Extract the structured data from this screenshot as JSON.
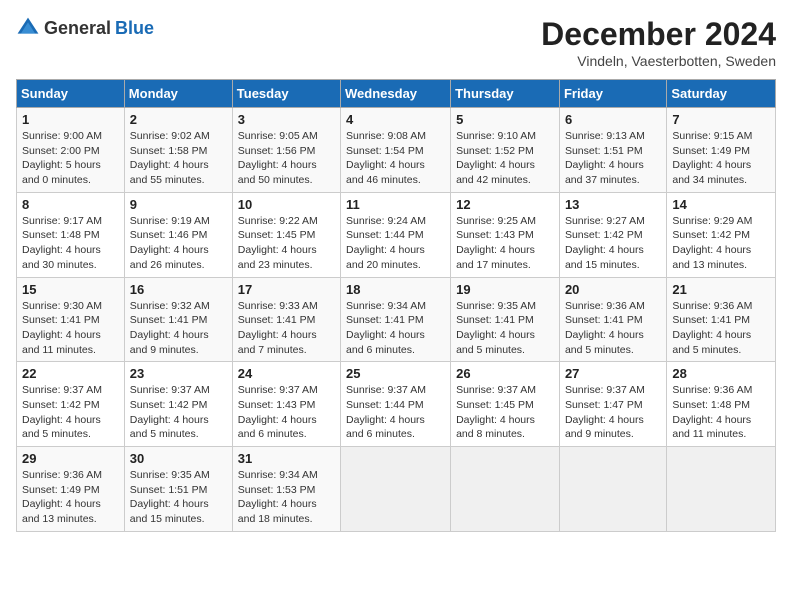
{
  "header": {
    "logo_general": "General",
    "logo_blue": "Blue",
    "month_title": "December 2024",
    "subtitle": "Vindeln, Vaesterbotten, Sweden"
  },
  "days_of_week": [
    "Sunday",
    "Monday",
    "Tuesday",
    "Wednesday",
    "Thursday",
    "Friday",
    "Saturday"
  ],
  "weeks": [
    [
      {
        "day": "1",
        "sunrise": "Sunrise: 9:00 AM",
        "sunset": "Sunset: 2:00 PM",
        "daylight": "Daylight: 5 hours and 0 minutes."
      },
      {
        "day": "2",
        "sunrise": "Sunrise: 9:02 AM",
        "sunset": "Sunset: 1:58 PM",
        "daylight": "Daylight: 4 hours and 55 minutes."
      },
      {
        "day": "3",
        "sunrise": "Sunrise: 9:05 AM",
        "sunset": "Sunset: 1:56 PM",
        "daylight": "Daylight: 4 hours and 50 minutes."
      },
      {
        "day": "4",
        "sunrise": "Sunrise: 9:08 AM",
        "sunset": "Sunset: 1:54 PM",
        "daylight": "Daylight: 4 hours and 46 minutes."
      },
      {
        "day": "5",
        "sunrise": "Sunrise: 9:10 AM",
        "sunset": "Sunset: 1:52 PM",
        "daylight": "Daylight: 4 hours and 42 minutes."
      },
      {
        "day": "6",
        "sunrise": "Sunrise: 9:13 AM",
        "sunset": "Sunset: 1:51 PM",
        "daylight": "Daylight: 4 hours and 37 minutes."
      },
      {
        "day": "7",
        "sunrise": "Sunrise: 9:15 AM",
        "sunset": "Sunset: 1:49 PM",
        "daylight": "Daylight: 4 hours and 34 minutes."
      }
    ],
    [
      {
        "day": "8",
        "sunrise": "Sunrise: 9:17 AM",
        "sunset": "Sunset: 1:48 PM",
        "daylight": "Daylight: 4 hours and 30 minutes."
      },
      {
        "day": "9",
        "sunrise": "Sunrise: 9:19 AM",
        "sunset": "Sunset: 1:46 PM",
        "daylight": "Daylight: 4 hours and 26 minutes."
      },
      {
        "day": "10",
        "sunrise": "Sunrise: 9:22 AM",
        "sunset": "Sunset: 1:45 PM",
        "daylight": "Daylight: 4 hours and 23 minutes."
      },
      {
        "day": "11",
        "sunrise": "Sunrise: 9:24 AM",
        "sunset": "Sunset: 1:44 PM",
        "daylight": "Daylight: 4 hours and 20 minutes."
      },
      {
        "day": "12",
        "sunrise": "Sunrise: 9:25 AM",
        "sunset": "Sunset: 1:43 PM",
        "daylight": "Daylight: 4 hours and 17 minutes."
      },
      {
        "day": "13",
        "sunrise": "Sunrise: 9:27 AM",
        "sunset": "Sunset: 1:42 PM",
        "daylight": "Daylight: 4 hours and 15 minutes."
      },
      {
        "day": "14",
        "sunrise": "Sunrise: 9:29 AM",
        "sunset": "Sunset: 1:42 PM",
        "daylight": "Daylight: 4 hours and 13 minutes."
      }
    ],
    [
      {
        "day": "15",
        "sunrise": "Sunrise: 9:30 AM",
        "sunset": "Sunset: 1:41 PM",
        "daylight": "Daylight: 4 hours and 11 minutes."
      },
      {
        "day": "16",
        "sunrise": "Sunrise: 9:32 AM",
        "sunset": "Sunset: 1:41 PM",
        "daylight": "Daylight: 4 hours and 9 minutes."
      },
      {
        "day": "17",
        "sunrise": "Sunrise: 9:33 AM",
        "sunset": "Sunset: 1:41 PM",
        "daylight": "Daylight: 4 hours and 7 minutes."
      },
      {
        "day": "18",
        "sunrise": "Sunrise: 9:34 AM",
        "sunset": "Sunset: 1:41 PM",
        "daylight": "Daylight: 4 hours and 6 minutes."
      },
      {
        "day": "19",
        "sunrise": "Sunrise: 9:35 AM",
        "sunset": "Sunset: 1:41 PM",
        "daylight": "Daylight: 4 hours and 5 minutes."
      },
      {
        "day": "20",
        "sunrise": "Sunrise: 9:36 AM",
        "sunset": "Sunset: 1:41 PM",
        "daylight": "Daylight: 4 hours and 5 minutes."
      },
      {
        "day": "21",
        "sunrise": "Sunrise: 9:36 AM",
        "sunset": "Sunset: 1:41 PM",
        "daylight": "Daylight: 4 hours and 5 minutes."
      }
    ],
    [
      {
        "day": "22",
        "sunrise": "Sunrise: 9:37 AM",
        "sunset": "Sunset: 1:42 PM",
        "daylight": "Daylight: 4 hours and 5 minutes."
      },
      {
        "day": "23",
        "sunrise": "Sunrise: 9:37 AM",
        "sunset": "Sunset: 1:42 PM",
        "daylight": "Daylight: 4 hours and 5 minutes."
      },
      {
        "day": "24",
        "sunrise": "Sunrise: 9:37 AM",
        "sunset": "Sunset: 1:43 PM",
        "daylight": "Daylight: 4 hours and 6 minutes."
      },
      {
        "day": "25",
        "sunrise": "Sunrise: 9:37 AM",
        "sunset": "Sunset: 1:44 PM",
        "daylight": "Daylight: 4 hours and 6 minutes."
      },
      {
        "day": "26",
        "sunrise": "Sunrise: 9:37 AM",
        "sunset": "Sunset: 1:45 PM",
        "daylight": "Daylight: 4 hours and 8 minutes."
      },
      {
        "day": "27",
        "sunrise": "Sunrise: 9:37 AM",
        "sunset": "Sunset: 1:47 PM",
        "daylight": "Daylight: 4 hours and 9 minutes."
      },
      {
        "day": "28",
        "sunrise": "Sunrise: 9:36 AM",
        "sunset": "Sunset: 1:48 PM",
        "daylight": "Daylight: 4 hours and 11 minutes."
      }
    ],
    [
      {
        "day": "29",
        "sunrise": "Sunrise: 9:36 AM",
        "sunset": "Sunset: 1:49 PM",
        "daylight": "Daylight: 4 hours and 13 minutes."
      },
      {
        "day": "30",
        "sunrise": "Sunrise: 9:35 AM",
        "sunset": "Sunset: 1:51 PM",
        "daylight": "Daylight: 4 hours and 15 minutes."
      },
      {
        "day": "31",
        "sunrise": "Sunrise: 9:34 AM",
        "sunset": "Sunset: 1:53 PM",
        "daylight": "Daylight: 4 hours and 18 minutes."
      },
      null,
      null,
      null,
      null
    ]
  ]
}
